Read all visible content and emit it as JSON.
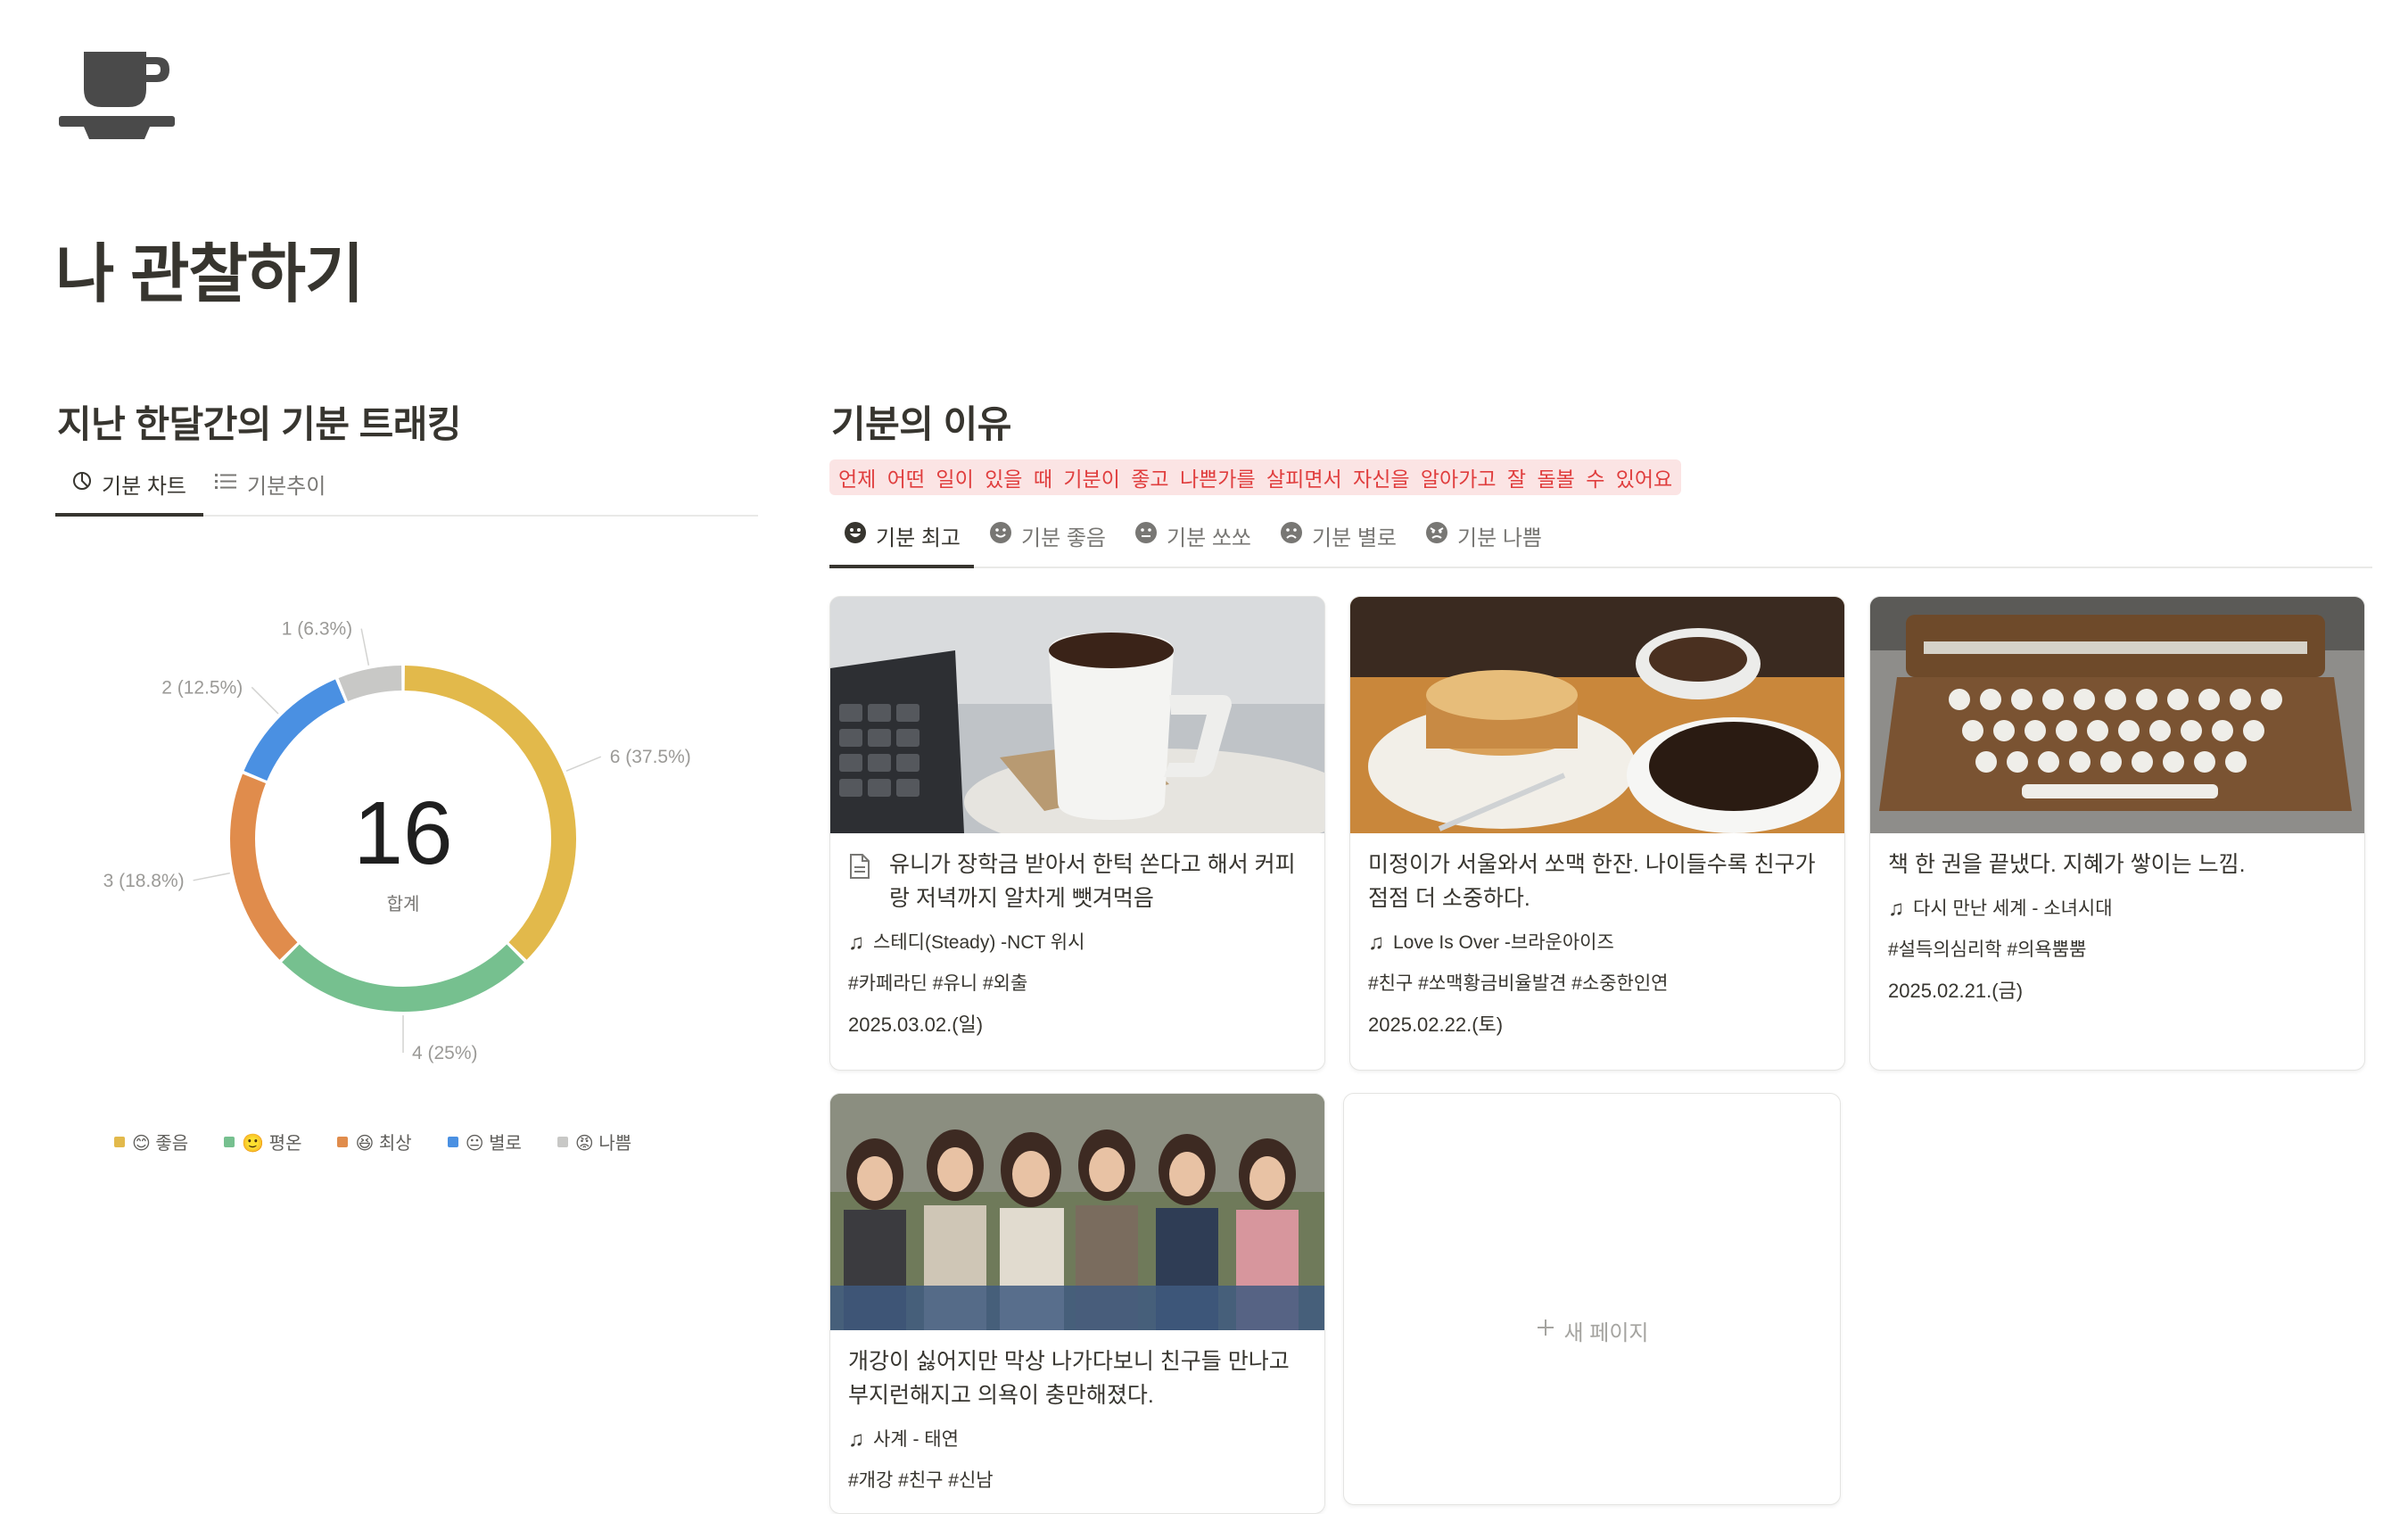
{
  "page": {
    "title": "나 관찰하기",
    "icon": "coffee-cup-icon"
  },
  "left_section": {
    "title": "지난 한달간의 기분 트래킹",
    "tabs": [
      {
        "label": "기분 차트",
        "icon": "pie-chart-icon",
        "active": true
      },
      {
        "label": "기분추이",
        "icon": "list-icon",
        "active": false
      }
    ]
  },
  "chart_data": {
    "type": "pie",
    "variant": "donut",
    "center_value": "16",
    "center_label": "합계",
    "slices": [
      {
        "name": "😊 좋음",
        "value": 6,
        "label": "6 (37.5%)",
        "color": "#e2b94b"
      },
      {
        "name": "🙂 평온",
        "value": 4,
        "label": "4 (25%)",
        "color": "#76c08f"
      },
      {
        "name": "😆 최상",
        "value": 3,
        "label": "3 (18.8%)",
        "color": "#e08c4c"
      },
      {
        "name": "😐 별로",
        "value": 2,
        "label": "2 (12.5%)",
        "color": "#4a90e2"
      },
      {
        "name": "😡 나쁨",
        "value": 1,
        "label": "1 (6.3%)",
        "color": "#c8c8c6"
      }
    ],
    "legend_position": "bottom"
  },
  "right_section": {
    "title": "기분의 이유",
    "hint": "언제 어떤 일이 있을 때 기분이 좋고 나쁜가를 살피면서 자신을  알아가고 잘 돌볼 수 있어요",
    "tabs": [
      {
        "label": "기분 최고",
        "icon": "grinning-face-icon",
        "active": true
      },
      {
        "label": "기분 좋음",
        "icon": "smiling-face-icon",
        "active": false
      },
      {
        "label": "기분 쏘쏘",
        "icon": "neutral-face-icon",
        "active": false
      },
      {
        "label": "기분 별로",
        "icon": "frowning-face-icon",
        "active": false
      },
      {
        "label": "기분 나쁨",
        "icon": "angry-face-icon",
        "active": false
      }
    ]
  },
  "cards": [
    {
      "title": "유니가 장학금 받아서 한턱 쏜다고 해서 커피랑 저녁까지 알차게 뺏겨먹음",
      "title_icon": "document-icon",
      "music": "스테디(Steady) -NCT 위시",
      "tags": "#카페라딘 #유니 #외출",
      "date": "2025.03.02.(일)",
      "image": "coffee-cup-laptop-photo"
    },
    {
      "title": "미정이가 서울와서 쏘맥 한잔. 나이들수록 친구가 점점 더 소중하다.",
      "music": "Love Is Over -브라운아이즈",
      "tags": "#친구 #쏘맥황금비율발견 #소중한인연",
      "date": "2025.02.22.(토)",
      "image": "cake-and-coffee-photo"
    },
    {
      "title": "책 한 권을 끝냈다. 지혜가 쌓이는 느낌.",
      "music": "다시 만난 세계 - 소녀시대",
      "tags": "#설득의심리학 #의욕뿜뿜",
      "date": "2025.02.21.(금)",
      "image": "typewriter-photo"
    },
    {
      "title": "개강이 싫어지만 막상 나가다보니 친구들 만나고 부지런해지고 의욕이 충만해졌다.",
      "music": "사계 - 태연",
      "tags": "#개강 #친구 #신남",
      "image": "students-group-photo"
    }
  ],
  "new_page": {
    "label": "새 페이지",
    "icon": "plus-icon"
  }
}
